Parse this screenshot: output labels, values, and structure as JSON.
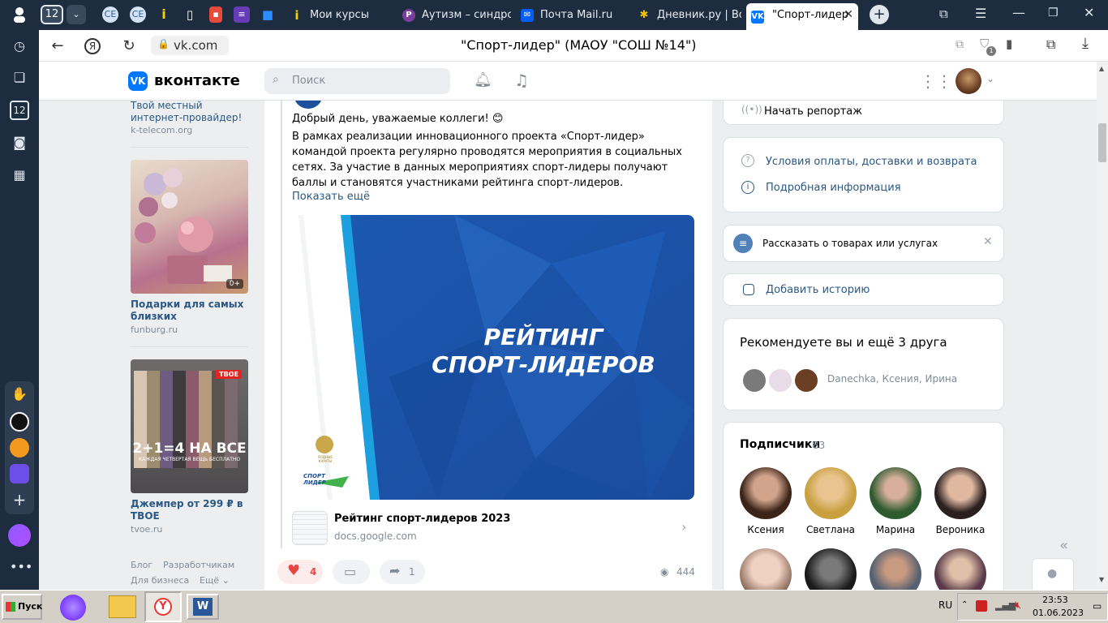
{
  "browser": {
    "tab_count": "12",
    "tabs": [
      {
        "label": "Мои курсы"
      },
      {
        "label": "Аутизм – синдро"
      },
      {
        "label": "Почта Mail.ru"
      },
      {
        "label": "Дневник.ру | Вод"
      },
      {
        "label": "\"Спорт-лидер"
      }
    ],
    "url": "vk.com",
    "page_title": "\"Спорт-лидер\" (МАОУ \"СОШ №14\")",
    "downloads_badge": "1",
    "sidebar_badge": "12"
  },
  "vk": {
    "logo": "вконтакте",
    "search_placeholder": "Поиск"
  },
  "ads": [
    {
      "title": "Твой местный интернет-провайдер!",
      "domain": "k-telecom.org"
    },
    {
      "title": "Подарки для самых близких",
      "domain": "funburg.ru",
      "badge": "0+"
    },
    {
      "title": "Джемпер от 299 ₽ в TBOE",
      "domain": "tvoe.ru",
      "banner_text": "2+1=4 НА ВСЕ",
      "banner_sub": "КАЖДАЯ ЧЕТВЕРТАЯ ВЕЩЬ БЕСПЛАТНО",
      "banner_brand": "TBOE"
    }
  ],
  "footer_links": [
    "Блог",
    "Разработчикам",
    "Для бизнеса",
    "Ещё"
  ],
  "post": {
    "greeting": "Добрый день, уважаемые коллеги! 😊",
    "text": "В рамках реализации инновационного проекта «Спорт-лидер» командой проекта регулярно проводятся мероприятия в социальных сетях. За участие в данных мероприятиях спорт-лидеры получают баллы и становятся участниками рейтинга спорт-лидеров.",
    "show_more": "Показать ещё",
    "image_title_line1": "РЕЙТИНГ",
    "image_title_line2": "СПОРТ-ЛИДЕРОВ",
    "image_logo_small": "РОДНЫЕ КАРАТЫ",
    "image_logo": "СПОРТ ЛИДЕР",
    "attachment_title": "Рейтинг спорт-лидеров 2023",
    "attachment_domain": "docs.google.com",
    "likes": "4",
    "shares": "1",
    "views": "444"
  },
  "right": {
    "report": "Начать репортаж",
    "payment_terms": "Условия оплаты, доставки и возврата",
    "details": "Подробная информация",
    "tell_goods": "Рассказать о товарах или услугах",
    "add_story": "Добавить историю",
    "recommend_title": "Рекомендуете вы и ещё 3 друга",
    "recommend_names": "Danechka, Ксения, Ирина",
    "subscribers_label": "Подписчики",
    "subscribers_count": "83",
    "subscribers": [
      "Ксения",
      "Светлана",
      "Марина",
      "Вероника"
    ]
  },
  "taskbar": {
    "start": "Пуск",
    "lang": "RU",
    "time": "23:53",
    "date": "01.06.2023"
  },
  "colors": {
    "vk_blue": "#0077ff",
    "browser_dark": "#1e2c3f",
    "image_blue": "#1f5fb8",
    "like_red": "#e64646"
  }
}
